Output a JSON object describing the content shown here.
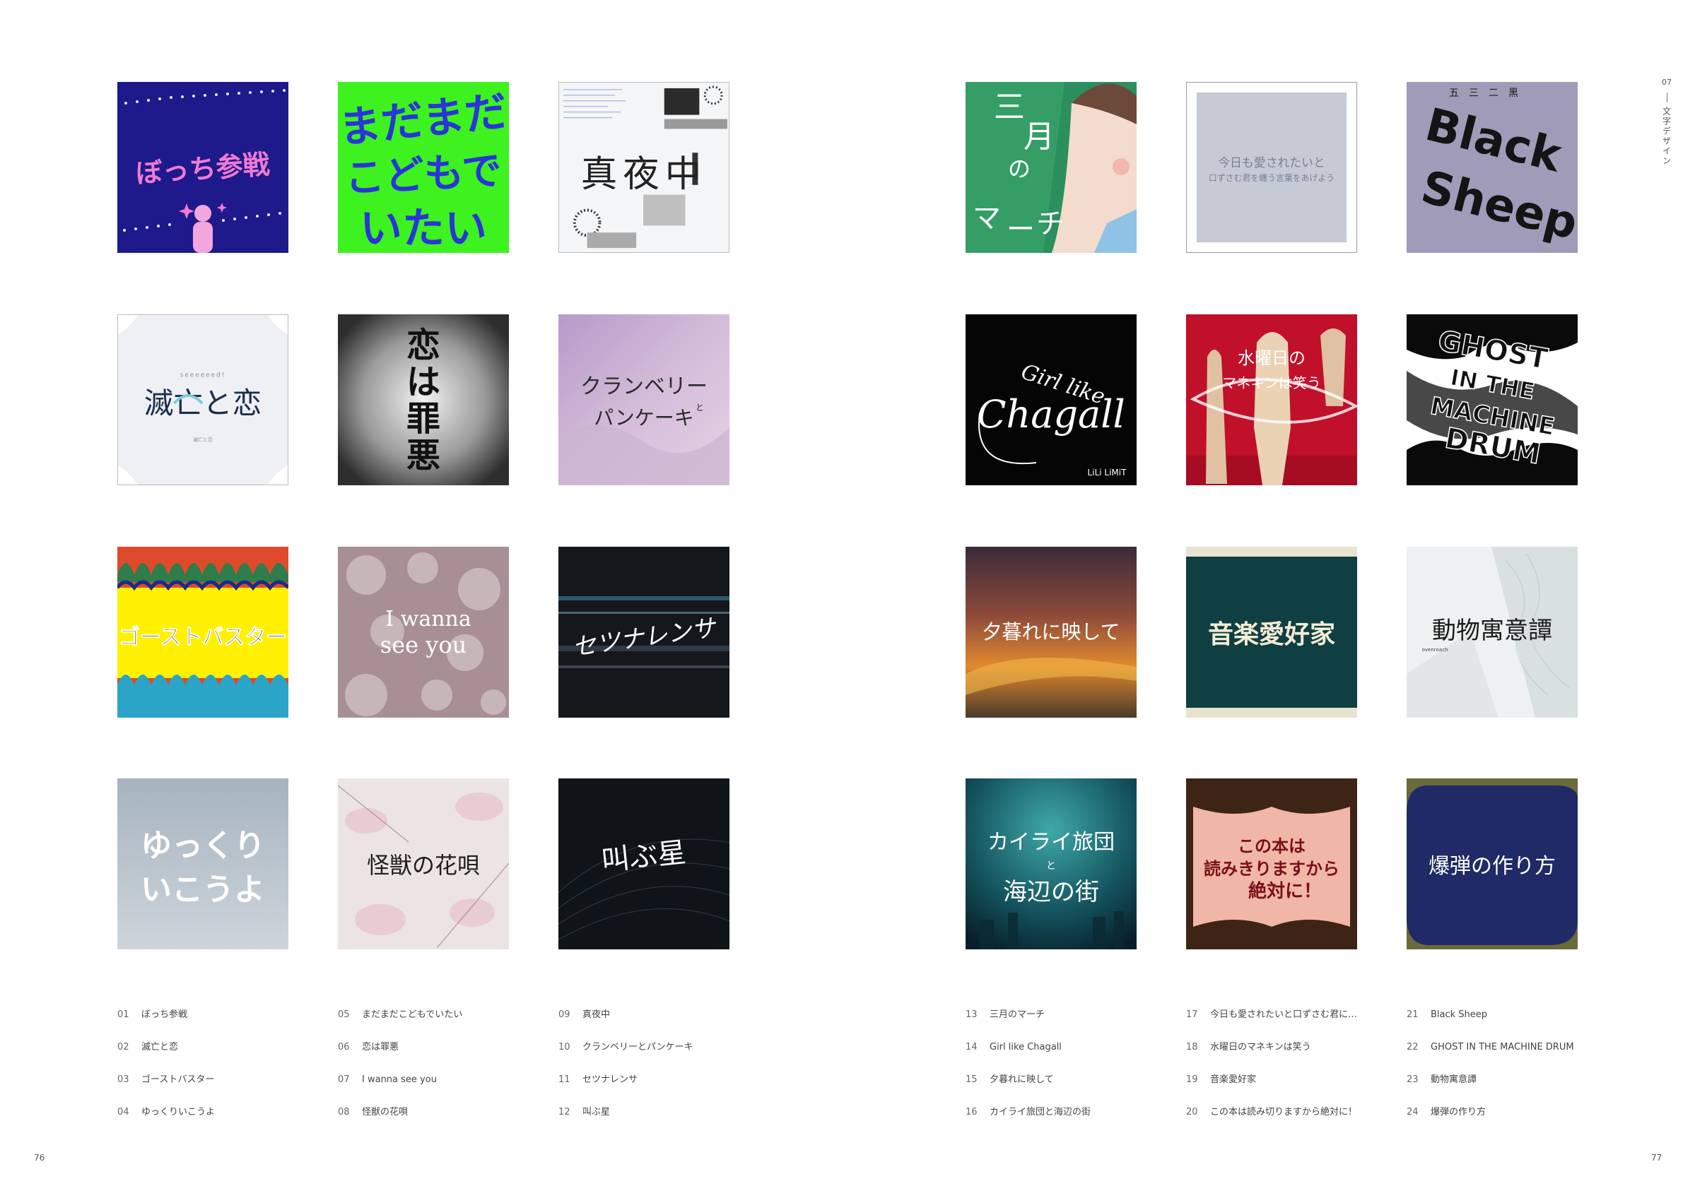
{
  "spread": {
    "left_page_number": "76",
    "right_page_number": "77",
    "running_head": {
      "number": "07",
      "title": "文字デザイン"
    }
  },
  "left_page": {
    "columns": [
      {
        "captions": [
          {
            "num": "01",
            "title": "ぼっち参戦"
          },
          {
            "num": "02",
            "title": "滅亡と恋"
          },
          {
            "num": "03",
            "title": "ゴーストバスター"
          },
          {
            "num": "04",
            "title": "ゆっくりいこうよ"
          }
        ]
      },
      {
        "captions": [
          {
            "num": "05",
            "title": "まだまだこどもでいたい"
          },
          {
            "num": "06",
            "title": "恋は罪悪"
          },
          {
            "num": "07",
            "title": "I wanna see you"
          },
          {
            "num": "08",
            "title": "怪獣の花唄"
          }
        ]
      },
      {
        "captions": [
          {
            "num": "09",
            "title": "真夜中"
          },
          {
            "num": "10",
            "title": "クランベリーとパンケーキ"
          },
          {
            "num": "11",
            "title": "セツナレンサ"
          },
          {
            "num": "12",
            "title": "叫ぶ星"
          }
        ]
      }
    ]
  },
  "right_page": {
    "columns": [
      {
        "captions": [
          {
            "num": "13",
            "title": "三月のマーチ"
          },
          {
            "num": "14",
            "title": "Girl like Chagall"
          },
          {
            "num": "15",
            "title": "夕暮れに映して"
          },
          {
            "num": "16",
            "title": "カイライ旅団と海辺の街"
          }
        ]
      },
      {
        "captions": [
          {
            "num": "17",
            "title": "今日も愛されたいと口ずさむ君に…"
          },
          {
            "num": "18",
            "title": "水曜日のマネキンは笑う"
          },
          {
            "num": "19",
            "title": "音楽愛好家"
          },
          {
            "num": "20",
            "title": "この本は読み切りますから絶対に！"
          }
        ]
      },
      {
        "captions": [
          {
            "num": "21",
            "title": "Black Sheep"
          },
          {
            "num": "22",
            "title": "GHOST IN THE MACHINE DRUM"
          },
          {
            "num": "23",
            "title": "動物寓意譚"
          },
          {
            "num": "24",
            "title": "爆弾の作り方"
          }
        ]
      }
    ]
  },
  "artworks": {
    "a01": {
      "main": "ぼっち参戦",
      "colors": {
        "bg": "#1e1a8c",
        "text": "#f07ad2"
      }
    },
    "a05": {
      "lines": [
        "まだまだ",
        "こどもで",
        "いたい"
      ],
      "colors": {
        "bg": "#3df21e",
        "text": "#2a34d8"
      }
    },
    "a09": {
      "main": "真夜中"
    },
    "a02": {
      "top": "seeeeeed!",
      "main": "滅亡と恋",
      "sub": "滅亡と恋"
    },
    "a06": {
      "lines": [
        "恋",
        "は",
        "罪",
        "悪"
      ]
    },
    "a10": {
      "main": "クランベリー",
      "mid": "と",
      "sub": "パンケーキ"
    },
    "a03": {
      "main": "ゴーストバスター"
    },
    "a07": {
      "line1": "I wanna",
      "line2": "see you"
    },
    "a11": {
      "main": "セツナレンサ"
    },
    "a04": {
      "line1": "ゆっくり",
      "line2": "いこうよ"
    },
    "a08": {
      "main": "怪獣の花唄"
    },
    "a12": {
      "main": "叫ぶ星"
    },
    "a13": {
      "lines": [
        "三",
        "月",
        "の",
        "マ",
        "ー",
        "チ"
      ]
    },
    "a17": {
      "line1": "今日も愛されたいと",
      "line2": "口ずさむ君を纏う言葉をあげよう"
    },
    "a21": {
      "lines": [
        "Black",
        "Sheep"
      ],
      "top": "五三二黒"
    },
    "a14": {
      "line1": "Girl like",
      "line2": "Chagall",
      "credit": "LiLi LiMiT"
    },
    "a18": {
      "line1": "水曜日の",
      "line2": "マネキンは笑う"
    },
    "a22": {
      "lines": [
        "GHOST",
        "IN THE",
        "MACHINE",
        "DRUM"
      ]
    },
    "a15": {
      "main": "夕暮れに映して"
    },
    "a19": {
      "main": "音楽愛好家"
    },
    "a23": {
      "main": "動物寓意譚",
      "credit": "ovenroach"
    },
    "a16": {
      "line1": "カイライ旅団",
      "mid": "と",
      "line2": "海辺の街"
    },
    "a20": {
      "line1": "この本は",
      "line2": "読みきりますから",
      "line3": "絶対に！"
    },
    "a24": {
      "main": "爆弾の作り方"
    }
  }
}
